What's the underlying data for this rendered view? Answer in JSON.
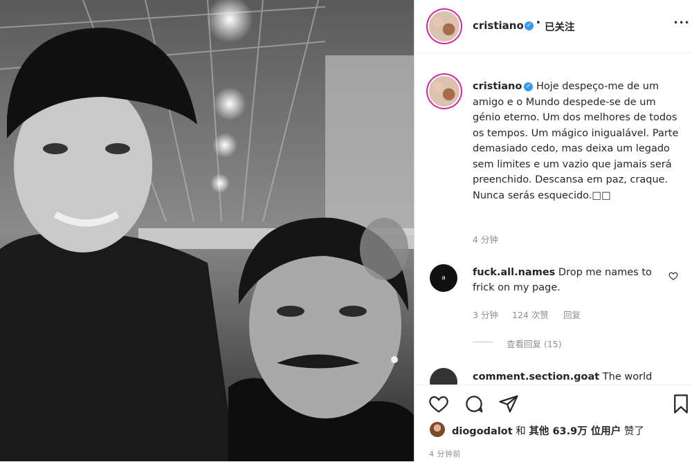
{
  "post": {
    "username": "cristiano",
    "follow_status": "已关注",
    "separator": "•",
    "more": "•••"
  },
  "caption": {
    "username": "cristiano",
    "text": "Hoje despeço-me de um amigo e o Mundo despede-se de um génio eterno. Um dos melhores de todos os tempos. Um mágico inigualável. Parte demasiado cedo, mas deixa um legado sem limites e um vazio que jamais será preenchido. Descansa em paz, craque. Nunca serás esquecido.□□",
    "time": "4 分钟"
  },
  "comments": [
    {
      "avatar_text": "a",
      "username": "fuck.all.names",
      "text": "Drop me names to frick on my page.",
      "time": "3 分钟",
      "likes": "124 次赞",
      "reply": "回复",
      "view_replies": "查看回复 (15)"
    },
    {
      "username": "comment.section.goat",
      "text": "The world"
    }
  ],
  "likes": {
    "user": "diogodalot",
    "connector": "和",
    "others": "其他 63.9万 位用户",
    "suffix": "赞了"
  },
  "timestamp": "4 分钟前",
  "icons": {
    "like": "heart-icon",
    "comment": "comment-icon",
    "share": "share-icon",
    "save": "bookmark-icon"
  }
}
